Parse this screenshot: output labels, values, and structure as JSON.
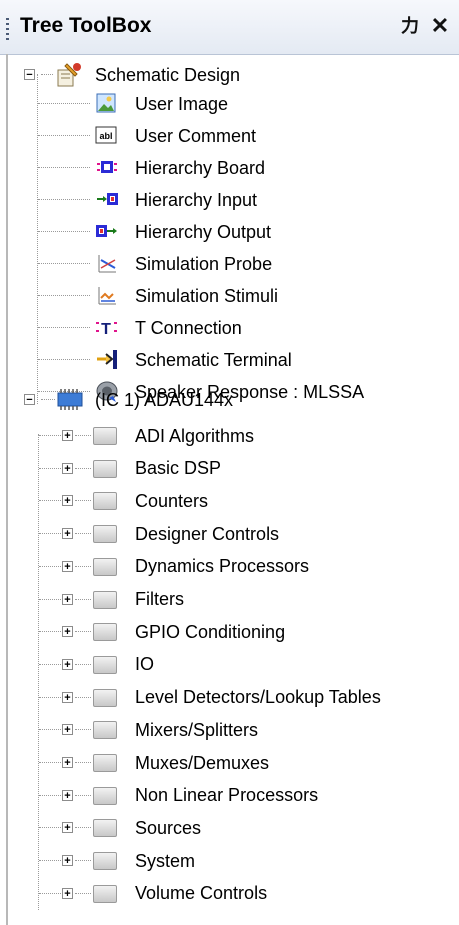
{
  "header": {
    "title": "Tree ToolBox"
  },
  "tree": {
    "schematic": {
      "label": "Schematic Design",
      "children": [
        {
          "label": "User Image",
          "icon": "image-icon"
        },
        {
          "label": "User Comment",
          "icon": "text-comment-icon",
          "glyph": "abl"
        },
        {
          "label": "Hierarchy Board",
          "icon": "hierarchy-board-icon"
        },
        {
          "label": "Hierarchy Input",
          "icon": "hierarchy-input-icon"
        },
        {
          "label": "Hierarchy Output",
          "icon": "hierarchy-output-icon"
        },
        {
          "label": "Simulation Probe",
          "icon": "probe-icon"
        },
        {
          "label": "Simulation Stimuli",
          "icon": "stimuli-icon"
        },
        {
          "label": "T Connection",
          "icon": "t-connection-icon",
          "glyph": "T"
        },
        {
          "label": "Schematic Terminal",
          "icon": "terminal-icon"
        },
        {
          "label": "Speaker Response : MLSSA",
          "icon": "speaker-icon"
        }
      ]
    },
    "ic": {
      "label": "(IC 1) ADAU144x",
      "children": [
        {
          "label": "ADI Algorithms"
        },
        {
          "label": "Basic DSP"
        },
        {
          "label": "Counters"
        },
        {
          "label": "Designer Controls"
        },
        {
          "label": "Dynamics Processors"
        },
        {
          "label": "Filters"
        },
        {
          "label": "GPIO Conditioning"
        },
        {
          "label": "IO"
        },
        {
          "label": "Level Detectors/Lookup Tables"
        },
        {
          "label": "Mixers/Splitters"
        },
        {
          "label": "Muxes/Demuxes"
        },
        {
          "label": "Non Linear Processors"
        },
        {
          "label": "Sources"
        },
        {
          "label": "System"
        },
        {
          "label": "Volume Controls"
        }
      ]
    }
  }
}
